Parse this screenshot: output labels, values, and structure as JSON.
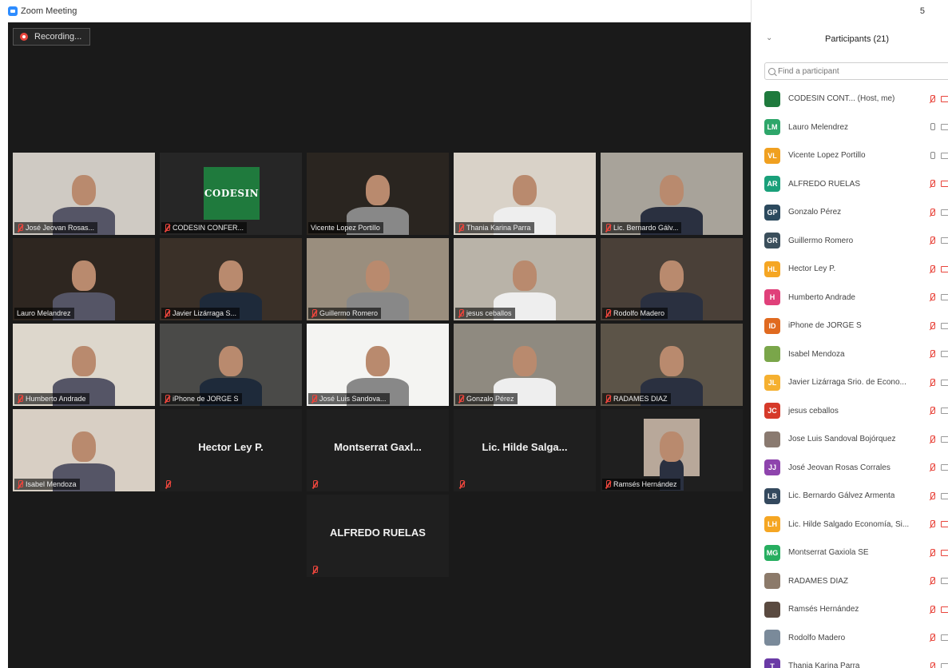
{
  "window": {
    "title": "Zoom Meeting"
  },
  "recording": {
    "label": "Recording..."
  },
  "panel_top": {
    "controls": "5"
  },
  "panel": {
    "title": "Participants (21)",
    "search_placeholder": "Find a participant"
  },
  "tiles": [
    {
      "label": "José Jeovan Rosas...",
      "muted": true
    },
    {
      "label": "CODESIN CONFER...",
      "muted": true,
      "logo": "CODESIN"
    },
    {
      "label": "Vicente Lopez Portillo",
      "muted": false
    },
    {
      "label": "Thania Karina Parra",
      "muted": true
    },
    {
      "label": "Lic. Bernardo Gálv...",
      "muted": true
    },
    {
      "label": "Lauro Melandrez",
      "muted": false,
      "active": true
    },
    {
      "label": "Javier Lizárraga S...",
      "muted": true
    },
    {
      "label": "Guillermo Romero",
      "muted": true
    },
    {
      "label": "jesus ceballos",
      "muted": true
    },
    {
      "label": "Rodolfo Madero",
      "muted": true
    },
    {
      "label": "Humberto Andrade",
      "muted": true
    },
    {
      "label": "iPhone de JORGE S",
      "muted": true
    },
    {
      "label": "José Luis Sandova...",
      "muted": true
    },
    {
      "label": "Gonzalo Pérez",
      "muted": true
    },
    {
      "label": "RADAMES DIAZ",
      "muted": true
    },
    {
      "label": "Isabel Mendoza",
      "muted": true
    },
    {
      "label": "Hector Ley P.",
      "muted": true,
      "name_only": true
    },
    {
      "label": "Montserrat Gaxl...",
      "muted": true,
      "name_only": true
    },
    {
      "label": "Lic. Hilde Salga...",
      "muted": true,
      "name_only": true
    },
    {
      "label": "Ramsés Hernández",
      "muted": true
    },
    {
      "label": "ALFREDO RUELAS",
      "muted": true,
      "name_only": true
    }
  ],
  "participants": [
    {
      "initials": "",
      "color": "#1f7a3d",
      "name": "CODESIN CONT... (Host, me)",
      "mic": "off",
      "video": "off"
    },
    {
      "initials": "LM",
      "color": "#2ea66a",
      "name": "Lauro Melendrez",
      "mic": "on",
      "video": "on"
    },
    {
      "initials": "VL",
      "color": "#f0a020",
      "name": "Vicente Lopez Portillo",
      "mic": "on",
      "video": "on"
    },
    {
      "initials": "AR",
      "color": "#1aa07a",
      "name": "ALFREDO RUELAS",
      "mic": "off",
      "video": "off"
    },
    {
      "initials": "GP",
      "color": "#2c4a5e",
      "name": "Gonzalo Pérez",
      "mic": "off",
      "video": "on"
    },
    {
      "initials": "GR",
      "color": "#3b4f5c",
      "name": "Guillermo Romero",
      "mic": "off",
      "video": "on"
    },
    {
      "initials": "HL",
      "color": "#f5a623",
      "name": "Hector Ley P.",
      "mic": "off",
      "video": "off"
    },
    {
      "initials": "H",
      "color": "#e0407a",
      "name": "Humberto Andrade",
      "mic": "off",
      "video": "on"
    },
    {
      "initials": "ID",
      "color": "#e06a20",
      "name": "iPhone de JORGE S",
      "mic": "off",
      "video": "on"
    },
    {
      "initials": "",
      "color": "#7aa64a",
      "name": "Isabel Mendoza",
      "mic": "off",
      "video": "on"
    },
    {
      "initials": "JL",
      "color": "#f5b030",
      "name": "Javier Lizárraga Srio. de Econo...",
      "mic": "off",
      "video": "on"
    },
    {
      "initials": "JC",
      "color": "#d63a2a",
      "name": "jesus ceballos",
      "mic": "off",
      "video": "on"
    },
    {
      "initials": "",
      "color": "#8a7a70",
      "name": "Jose Luis Sandoval Bojórquez",
      "mic": "off",
      "video": "on"
    },
    {
      "initials": "JJ",
      "color": "#8e44ad",
      "name": "José Jeovan Rosas Corrales",
      "mic": "off",
      "video": "on"
    },
    {
      "initials": "LB",
      "color": "#34495e",
      "name": "Lic. Bernardo Gálvez Armenta",
      "mic": "off",
      "video": "on"
    },
    {
      "initials": "LH",
      "color": "#f5a623",
      "name": "Lic. Hilde Salgado Economía, Si...",
      "mic": "off",
      "video": "off"
    },
    {
      "initials": "MG",
      "color": "#27ae60",
      "name": "Montserrat Gaxiola SE",
      "mic": "off",
      "video": "off"
    },
    {
      "initials": "",
      "color": "#8c7a6a",
      "name": "RADAMES DIAZ",
      "mic": "off",
      "video": "on"
    },
    {
      "initials": "",
      "color": "#5a4a40",
      "name": "Ramsés Hernández",
      "mic": "off",
      "video": "off"
    },
    {
      "initials": "",
      "color": "#7a8a9a",
      "name": "Rodolfo Madero",
      "mic": "off",
      "video": "on"
    },
    {
      "initials": "T",
      "color": "#6a3aa6",
      "name": "Thania Karina Parra",
      "mic": "off",
      "video": "on"
    }
  ]
}
